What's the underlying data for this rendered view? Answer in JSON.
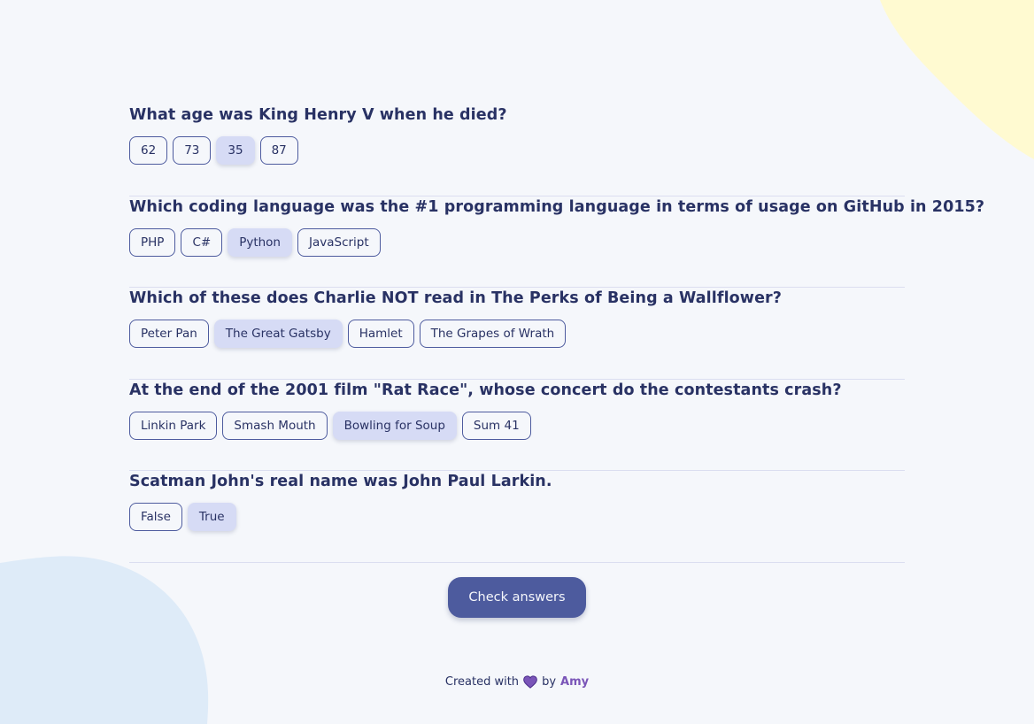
{
  "questions": [
    {
      "text": "What age was King Henry V when he died?",
      "answers": [
        "62",
        "73",
        "35",
        "87"
      ],
      "selected_index": 2
    },
    {
      "text": "Which coding language was the #1 programming language in terms of usage on GitHub in 2015?",
      "answers": [
        "PHP",
        "C#",
        "Python",
        "JavaScript"
      ],
      "selected_index": 2
    },
    {
      "text": "Which of these does Charlie NOT read in The Perks of Being a Wallflower?",
      "answers": [
        "Peter Pan",
        "The Great Gatsby",
        "Hamlet",
        "The Grapes of Wrath"
      ],
      "selected_index": 1
    },
    {
      "text": "At the end of the 2001 film \"Rat Race\", whose concert do the contestants crash?",
      "answers": [
        "Linkin Park",
        "Smash Mouth",
        "Bowling for Soup",
        "Sum 41"
      ],
      "selected_index": 2
    },
    {
      "text": "Scatman John's real name was John Paul Larkin.",
      "answers": [
        "False",
        "True"
      ],
      "selected_index": 1
    }
  ],
  "check_button_label": "Check answers",
  "footer": {
    "prefix": "Created with",
    "icon": "heart-icon",
    "by": "by",
    "author": "Amy"
  },
  "colors": {
    "background": "#f5f7fb",
    "text": "#293264",
    "accent": "#4d5b9e",
    "selected": "#d6dbf5",
    "blob_yellow": "#fffad1",
    "blob_blue": "#deebf8",
    "heart": "#7a55b8"
  }
}
